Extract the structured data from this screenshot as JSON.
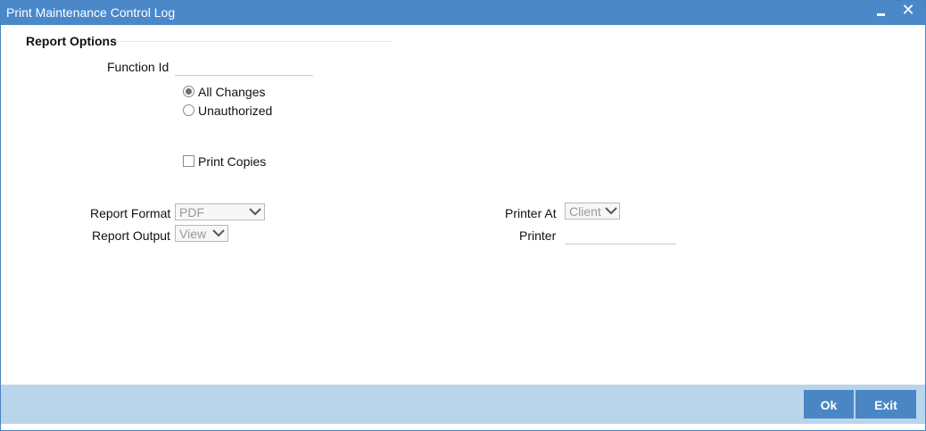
{
  "window": {
    "title": "Print Maintenance Control Log"
  },
  "report_options": {
    "section_title": "Report Options",
    "function_id": {
      "label": "Function Id",
      "value": ""
    },
    "change_type": {
      "options": [
        {
          "label": "All Changes",
          "checked": true
        },
        {
          "label": "Unauthorized",
          "checked": false
        }
      ]
    },
    "print_copies": {
      "label": "Print Copies",
      "checked": false
    }
  },
  "report_format": {
    "label": "Report Format",
    "value": "PDF"
  },
  "report_output": {
    "label": "Report Output",
    "value": "View"
  },
  "printer_at": {
    "label": "Printer At",
    "value": "Client"
  },
  "printer": {
    "label": "Printer",
    "value": ""
  },
  "footer": {
    "ok_label": "Ok",
    "exit_label": "Exit"
  },
  "colors": {
    "titlebar": "#4a88c9",
    "footer": "#b9d5ec",
    "button": "#4a86c3"
  }
}
